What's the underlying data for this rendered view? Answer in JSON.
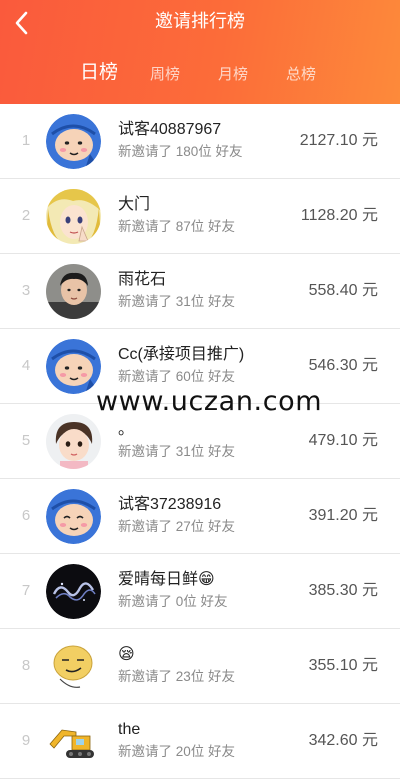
{
  "header": {
    "title": "邀请排行榜",
    "tabs": [
      {
        "label": "日榜",
        "active": true
      },
      {
        "label": "周榜",
        "active": false
      },
      {
        "label": "月榜",
        "active": false
      },
      {
        "label": "总榜",
        "active": false
      }
    ],
    "back_icon": "chevron-left-icon",
    "colors": {
      "gradient_start": "#fa5a3c",
      "gradient_end": "#fd8a3a"
    }
  },
  "ranking": [
    {
      "rank": "1",
      "name": "试客40887967",
      "invited": "新邀请了 180位 好友",
      "amount": "2127.10 元",
      "avatar": "blue-hood-cartoon"
    },
    {
      "rank": "2",
      "name": "大门",
      "invited": "新邀请了 87位 好友",
      "amount": "1128.20 元",
      "avatar": "anime-girl"
    },
    {
      "rank": "3",
      "name": "雨花石",
      "invited": "新邀请了 31位 好友",
      "amount": "558.40 元",
      "avatar": "boy-photo"
    },
    {
      "rank": "4",
      "name": "Cc(承接项目推广)",
      "invited": "新邀请了 60位 好友",
      "amount": "546.30 元",
      "avatar": "blue-hood-cartoon"
    },
    {
      "rank": "5",
      "name": "。",
      "invited": "新邀请了 31位 好友",
      "amount": "479.10 元",
      "avatar": "baby-photo"
    },
    {
      "rank": "6",
      "name": "试客37238916",
      "invited": "新邀请了 27位 好友",
      "amount": "391.20 元",
      "avatar": "blue-hood-cartoon"
    },
    {
      "rank": "7",
      "name": "爱晴每日鲜😁",
      "invited": "新邀请了 0位 好友",
      "amount": "385.30 元",
      "avatar": "dark-sparkle"
    },
    {
      "rank": "8",
      "name": "😪",
      "invited": "新邀请了 23位 好友",
      "amount": "355.10 元",
      "avatar": "smirk-face"
    },
    {
      "rank": "9",
      "name": "the",
      "invited": "新邀请了 20位 好友",
      "amount": "342.60 元",
      "avatar": "yellow-excavator"
    }
  ],
  "watermark": "www.uczan.com"
}
